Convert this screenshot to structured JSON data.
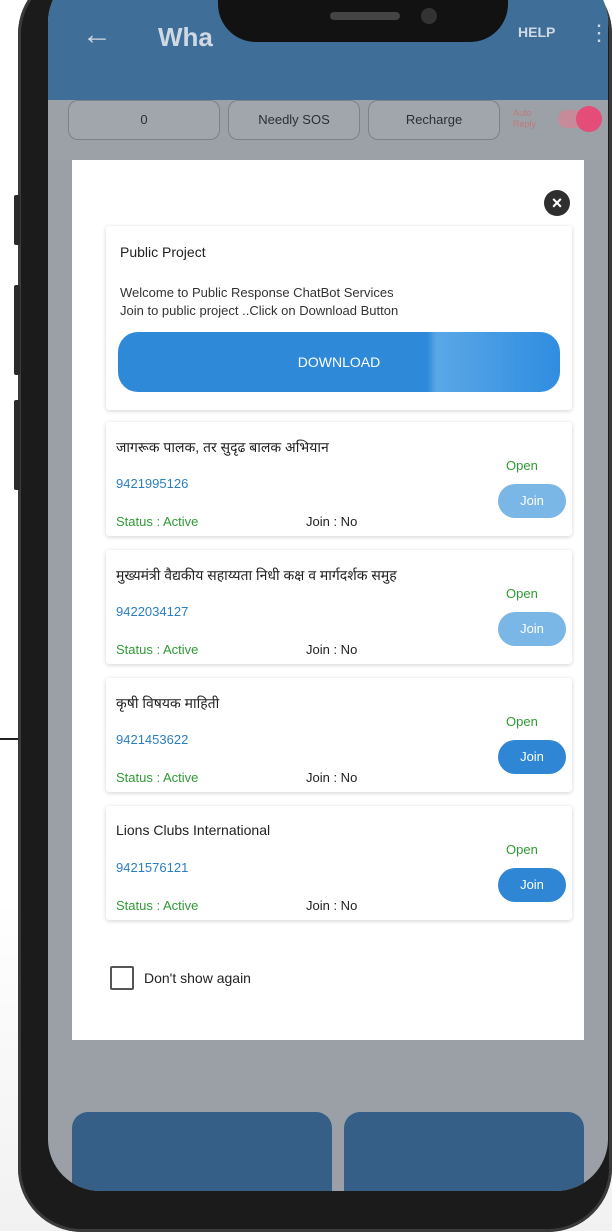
{
  "app": {
    "title": "Wha",
    "help": "HELP",
    "back_icon": "arrow-left-icon",
    "more_icon": "more-vert-icon"
  },
  "toolbar": {
    "counter": "0",
    "needy_sos": "Needly SOS",
    "recharge": "Recharge",
    "auto_reply": "Auto Reply"
  },
  "dialog": {
    "close_icon": "close-icon",
    "public_project": {
      "title": "Public Project",
      "line1": "Welcome to Public Response ChatBot Services",
      "line2": "Join to public project ..Click on Download Button",
      "download_label": "DOWNLOAD"
    },
    "items": [
      {
        "title": "जागरूक पालक, तर सुदृढ बालक अभियान",
        "phone": "9421995126",
        "status": "Status : Active",
        "join": "Join  : No",
        "open": "Open",
        "join_button": "Join",
        "button_color": "#7bb7e6"
      },
      {
        "title": "मुख्यमंत्री वैद्यकीय सहाय्यता निधी कक्ष व मार्गदर्शक समुह",
        "phone": "9422034127",
        "status": "Status : Active",
        "join": "Join  : No",
        "open": "Open",
        "join_button": "Join",
        "button_color": "#7bb7e6"
      },
      {
        "title": "कृषी विषयक माहिती",
        "phone": "9421453622",
        "status": "Status : Active",
        "join": "Join  : No",
        "open": "Open",
        "join_button": "Join",
        "button_color": "#2e86d4"
      },
      {
        "title": "Lions Clubs International",
        "phone": "9421576121",
        "status": "Status : Active",
        "join": "Join  : No",
        "open": "Open",
        "join_button": "Join",
        "button_color": "#2e86d4"
      }
    ],
    "dont_show": "Don't show again"
  },
  "colors": {
    "accent": "#2e86d4",
    "status_green": "#2f9a35",
    "phone_blue": "#2a7fc1"
  }
}
